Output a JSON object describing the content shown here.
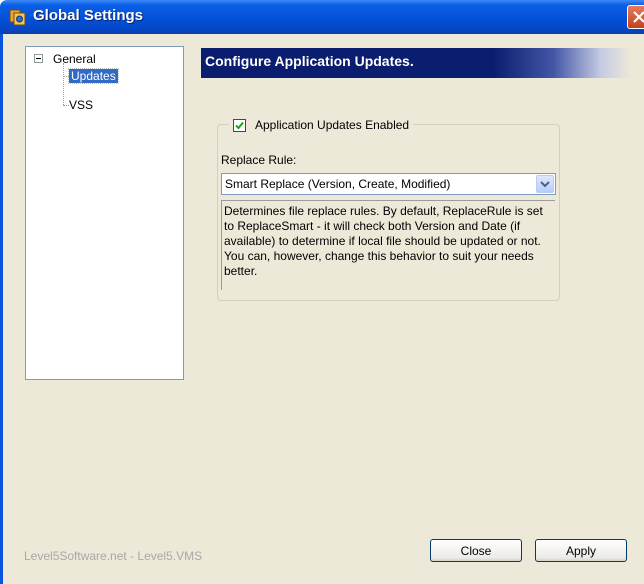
{
  "window": {
    "title": "Global Settings"
  },
  "tree": {
    "root_label": "General",
    "children": [
      {
        "label": "Updates",
        "selected": true
      },
      {
        "label": "VSS",
        "selected": false
      }
    ]
  },
  "panel": {
    "header": "Configure Application Updates.",
    "enabled_checkbox": {
      "label": "Application Updates Enabled",
      "checked": true
    },
    "replace_rule": {
      "label": "Replace Rule:",
      "selected_value": "Smart Replace (Version, Create, Modified)"
    },
    "description": "Determines file replace rules. By default, ReplaceRule is set to ReplaceSmart - it will check both Version and Date (if available) to determine if local file should be updated or not. You can, however, change this behavior to suit your needs better."
  },
  "footer": {
    "brand": "Level5Software.net - Level5.VMS",
    "close_label": "Close",
    "apply_label": "Apply"
  },
  "colors": {
    "titlebar": "#0451d8",
    "banner": "#0a1d6e",
    "selection": "#316ac5",
    "window_bg": "#ece9d8"
  }
}
